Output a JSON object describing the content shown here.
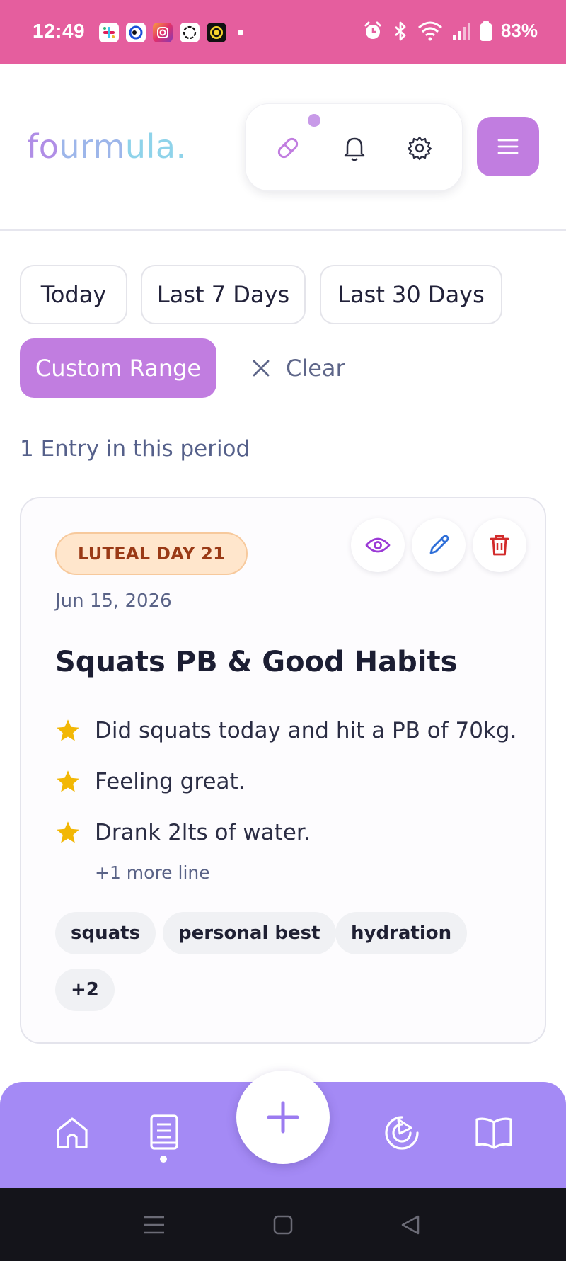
{
  "status_bar": {
    "time": "12:49",
    "battery": "83%",
    "icons": [
      "slack-icon",
      "app-icon",
      "instagram-icon",
      "chatgpt-icon",
      "coin-icon",
      "alarm-icon",
      "bluetooth-icon",
      "wifi-icon",
      "signal-icon",
      "battery-icon"
    ]
  },
  "header": {
    "logo": {
      "part1": "fo",
      "part2": "urm",
      "part3": "ula."
    },
    "icons": [
      "pill-icon",
      "bell-icon",
      "gear-icon",
      "hamburger-menu-icon"
    ],
    "colors": {
      "accent": "#c17de0",
      "status_bar": "#e55e9e"
    }
  },
  "filters": {
    "options": [
      "Today",
      "Last 7 Days",
      "Last 30 Days",
      "Custom Range"
    ],
    "active": "Custom Range",
    "clear_label": "Clear"
  },
  "entries_count": "1 Entry in this period",
  "entry": {
    "phase_badge": "LUTEAL DAY 21",
    "date": "Jun 15, 2026",
    "title": "Squats PB & Good Habits",
    "lines": [
      "Did squats today and hit a PB of 70kg.",
      "Feeling great.",
      "Drank 2lts of water."
    ],
    "more": "+1 more line",
    "tags": [
      "squats",
      "personal best",
      "hydration",
      "+2"
    ],
    "actions": [
      "eye-icon",
      "pencil-icon",
      "trash-icon"
    ]
  },
  "bottom_nav": {
    "items": [
      "home-icon",
      "journal-icon",
      "add-icon",
      "progress-icon",
      "book-icon"
    ],
    "active": "journal-icon",
    "color": "#a48af5"
  }
}
